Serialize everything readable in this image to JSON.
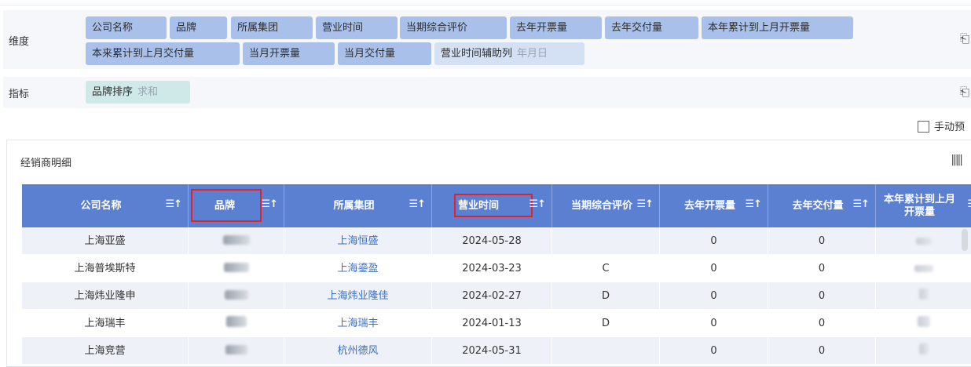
{
  "dimensions": {
    "label": "维度",
    "fields": [
      {
        "label": "公司名称"
      },
      {
        "label": "品牌"
      },
      {
        "label": "所属集团"
      },
      {
        "label": "营业时间"
      },
      {
        "label": "当期综合评价"
      },
      {
        "label": "去年开票量"
      },
      {
        "label": "去年交付量"
      },
      {
        "label": "本年累计到上月开票量"
      },
      {
        "label": "本来累计到上月交付量"
      },
      {
        "label": "当月开票量"
      },
      {
        "label": "当月交付量"
      },
      {
        "label": "营业时间辅助列",
        "sub": "年月日"
      }
    ]
  },
  "indicators": {
    "label": "指标",
    "fields": [
      {
        "label": "品牌排序",
        "sub": "求和"
      }
    ]
  },
  "manual_preview": {
    "label": "手动预"
  },
  "panel": {
    "title": "经销商明细"
  },
  "table": {
    "columns": [
      "公司名称",
      "品牌",
      "所属集团",
      "营业时间",
      "当期综合评价",
      "去年开票量",
      "去年交付量",
      "本年累计到上月开票量"
    ],
    "highlighted_columns": [
      "品牌",
      "营业时间"
    ],
    "rows": [
      {
        "company": "上海亚盛",
        "brand": "",
        "group": "上海恒盛",
        "open_date": "2024-05-28",
        "rating": "",
        "last_year_invoice": "0",
        "last_year_delivery": "0",
        "ytd_invoice": ""
      },
      {
        "company": "上海普埃斯特",
        "brand": "",
        "group": "上海鎏盈",
        "open_date": "2024-03-23",
        "rating": "C",
        "last_year_invoice": "0",
        "last_year_delivery": "0",
        "ytd_invoice": ""
      },
      {
        "company": "上海炜业隆申",
        "brand": "",
        "group": "上海炜业隆佳",
        "open_date": "2024-02-27",
        "rating": "D",
        "last_year_invoice": "0",
        "last_year_delivery": "0",
        "ytd_invoice": ""
      },
      {
        "company": "上海瑞丰",
        "brand": "",
        "group": "上海瑞丰",
        "open_date": "2024-01-13",
        "rating": "D",
        "last_year_invoice": "0",
        "last_year_delivery": "0",
        "ytd_invoice": ""
      },
      {
        "company": "上海竞营",
        "brand": "",
        "group": "杭州德风",
        "open_date": "2024-05-31",
        "rating": "",
        "last_year_invoice": "0",
        "last_year_delivery": "0",
        "ytd_invoice": ""
      }
    ]
  },
  "colors": {
    "header_bg": "#5b7fd1",
    "pill_bg": "#a9c1ea",
    "highlight": "#e0222b",
    "link": "#3b6fc7"
  }
}
